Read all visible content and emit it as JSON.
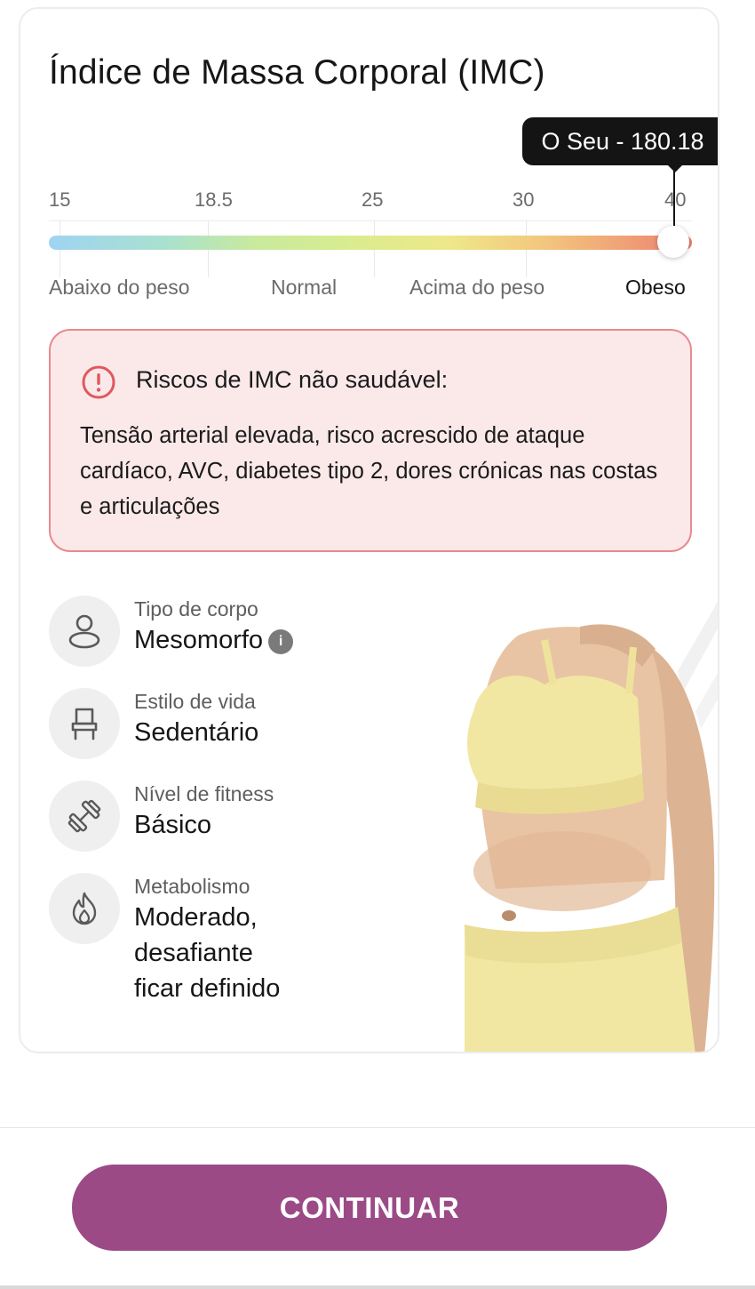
{
  "card": {
    "title": "Índice de Massa Corporal (IMC)",
    "tooltip": "O Seu - 180.18",
    "scale_ticks": [
      "15",
      "18.5",
      "25",
      "30",
      "40"
    ],
    "categories": [
      "Abaixo do peso",
      "Normal",
      "Acima do peso",
      "Obeso"
    ],
    "active_category": "Obeso",
    "bmi_value": 180.18
  },
  "risk": {
    "title": "Riscos de IMC não saudável:",
    "text": "Tensão arterial elevada, risco acrescido de ataque cardíaco, AVC, diabetes tipo 2, dores crónicas nas costas e articulações",
    "icon": "alert-circle-icon",
    "border_color": "#e98a8e",
    "bg_color": "#fbe9ea"
  },
  "stats": [
    {
      "label": "Tipo de corpo",
      "value": "Mesomorfo",
      "icon": "user-icon"
    },
    {
      "label": "Estilo de vida",
      "value": "Sedentário",
      "icon": "chair-icon"
    },
    {
      "label": "Nível de fitness",
      "value": "Básico",
      "icon": "dumbbell-icon"
    },
    {
      "label": "Metabolismo",
      "value_lines": [
        "Moderado,",
        "desafiante",
        "ficar definido"
      ],
      "icon": "flame-icon"
    }
  ],
  "footer": {
    "continue_label": "CONTINUAR",
    "button_color": "#9b4a86"
  }
}
